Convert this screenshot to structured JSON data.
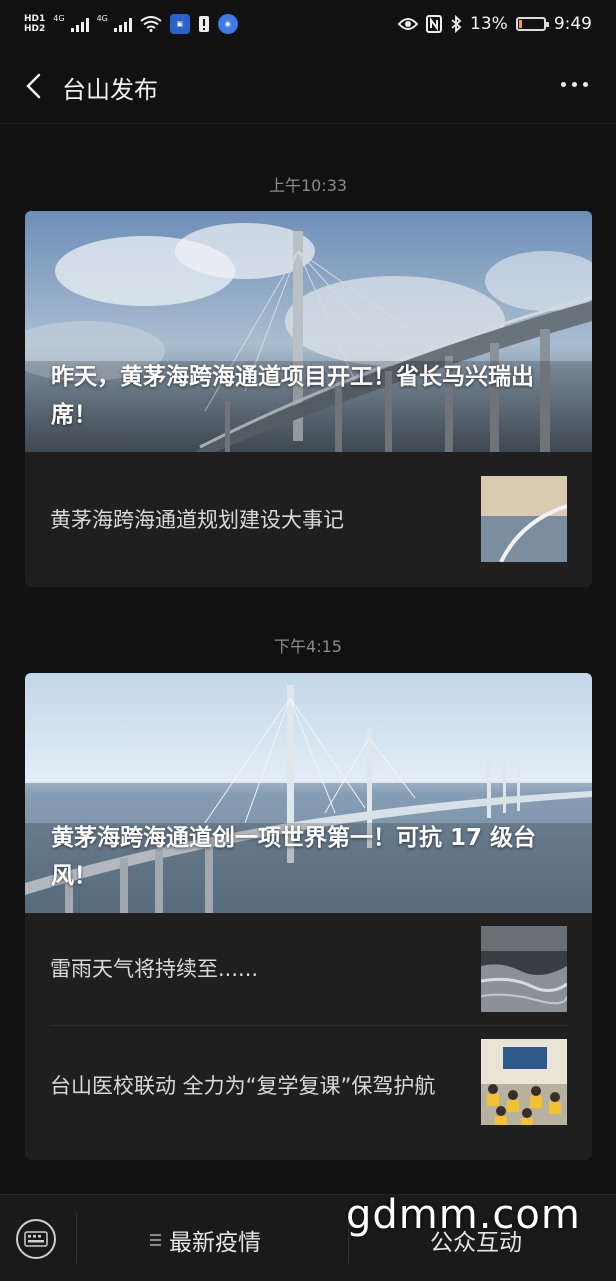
{
  "status_bar": {
    "hd1": "HD1",
    "hd2": "HD2",
    "net1": "4G",
    "net2": "4G",
    "battery_percent": "13%",
    "time": "9:49",
    "battery_level": 0.13
  },
  "nav": {
    "title": "台山发布"
  },
  "messages": [
    {
      "time": "上午10:33",
      "hero_title": "昨天，黄茅海跨海通道项目开工！省长马兴瑞出席！",
      "items": [
        {
          "text": "黄茅海跨海通道规划建设大事记"
        }
      ]
    },
    {
      "time": "下午4:15",
      "hero_title": "黄茅海跨海通道创一项世界第一！可抗 17 级台风！",
      "items": [
        {
          "text": "雷雨天气将持续至......"
        },
        {
          "text": "台山医校联动 全力为“复学复课”保驾护航"
        }
      ]
    }
  ],
  "bottom_menu": {
    "item1": "最新疫情",
    "item2": "公众互动"
  },
  "watermark": "gdmm.com"
}
